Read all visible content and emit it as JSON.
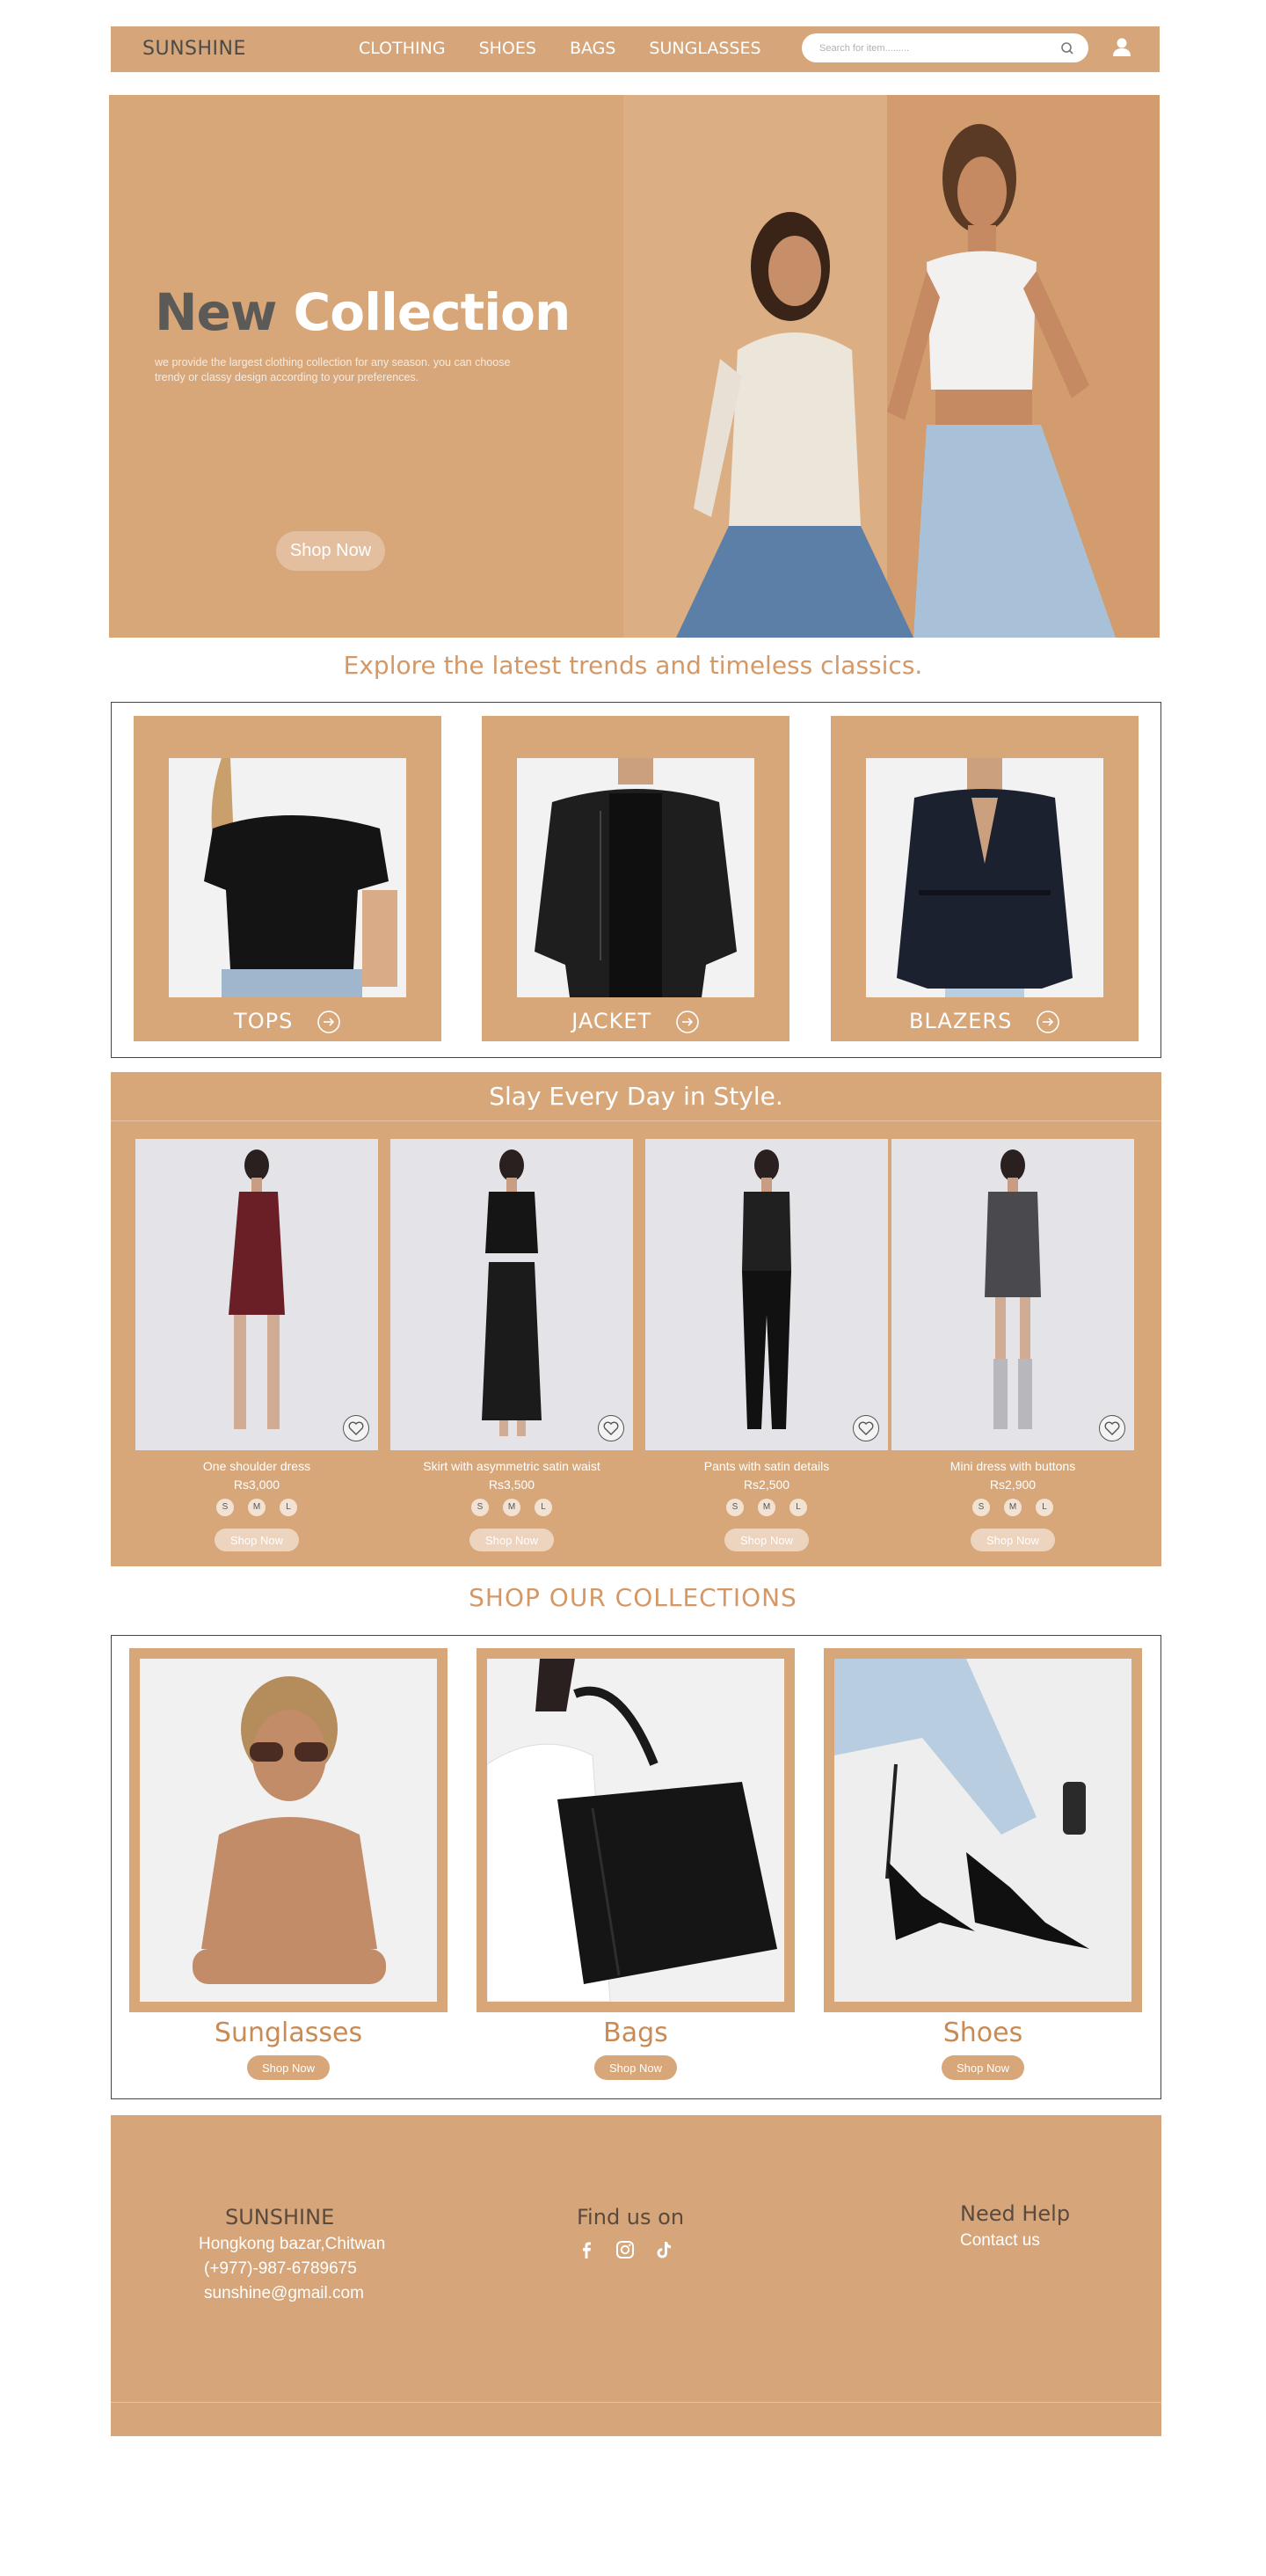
{
  "header": {
    "brand": "SUNSHINE",
    "nav": [
      "CLOTHING",
      "SHOES",
      "BAGS",
      "SUNGLASSES"
    ],
    "search_placeholder": "Search for item.........",
    "search_icon": "search-icon",
    "user_icon": "user-icon"
  },
  "hero": {
    "title_word1": "New",
    "title_word2": "Collection",
    "description": "we provide the largest clothing collection for any season. you can choose trendy or classy design according to your preferences.",
    "button": "Shop Now"
  },
  "tagline": "Explore the latest trends and timeless classics.",
  "categories": [
    {
      "label": "TOPS",
      "icon": "arrow-right-circle-icon"
    },
    {
      "label": "JACKET",
      "icon": "arrow-right-circle-icon"
    },
    {
      "label": "BLAZERS",
      "icon": "arrow-right-circle-icon"
    }
  ],
  "style_section": {
    "title": "Slay Every Day in Style.",
    "products": [
      {
        "name": "One shoulder dress",
        "price": "Rs3,000",
        "sizes": [
          "S",
          "M",
          "L"
        ],
        "button": "Shop Now"
      },
      {
        "name": "Skirt with asymmetric satin waist",
        "price": "Rs3,500",
        "sizes": [
          "S",
          "M",
          "L"
        ],
        "button": "Shop Now"
      },
      {
        "name": "Pants with satin details",
        "price": "Rs2,500",
        "sizes": [
          "S",
          "M",
          "L"
        ],
        "button": "Shop Now"
      },
      {
        "name": "Mini  dress with buttons",
        "price": "Rs2,900",
        "sizes": [
          "S",
          "M",
          "L"
        ],
        "button": "Shop Now"
      }
    ]
  },
  "collections": {
    "heading": "SHOP OUR COLLECTIONS",
    "items": [
      {
        "label": "Sunglasses",
        "button": "Shop Now"
      },
      {
        "label": "Bags",
        "button": "Shop Now"
      },
      {
        "label": "Shoes",
        "button": "Shop Now"
      }
    ]
  },
  "footer": {
    "brand": "SUNSHINE",
    "address": "Hongkong bazar,Chitwan",
    "phone": "(+977)-987-6789675",
    "email": "sunshine@gmail.com",
    "find_us": "Find us on",
    "socials": [
      "facebook-icon",
      "instagram-icon",
      "tiktok-icon"
    ],
    "help_head": "Need Help",
    "contact": "Contact us"
  },
  "colors": {
    "accent": "#d7a77a",
    "accent_text": "#d49867",
    "dark_text": "#5c5a57"
  }
}
